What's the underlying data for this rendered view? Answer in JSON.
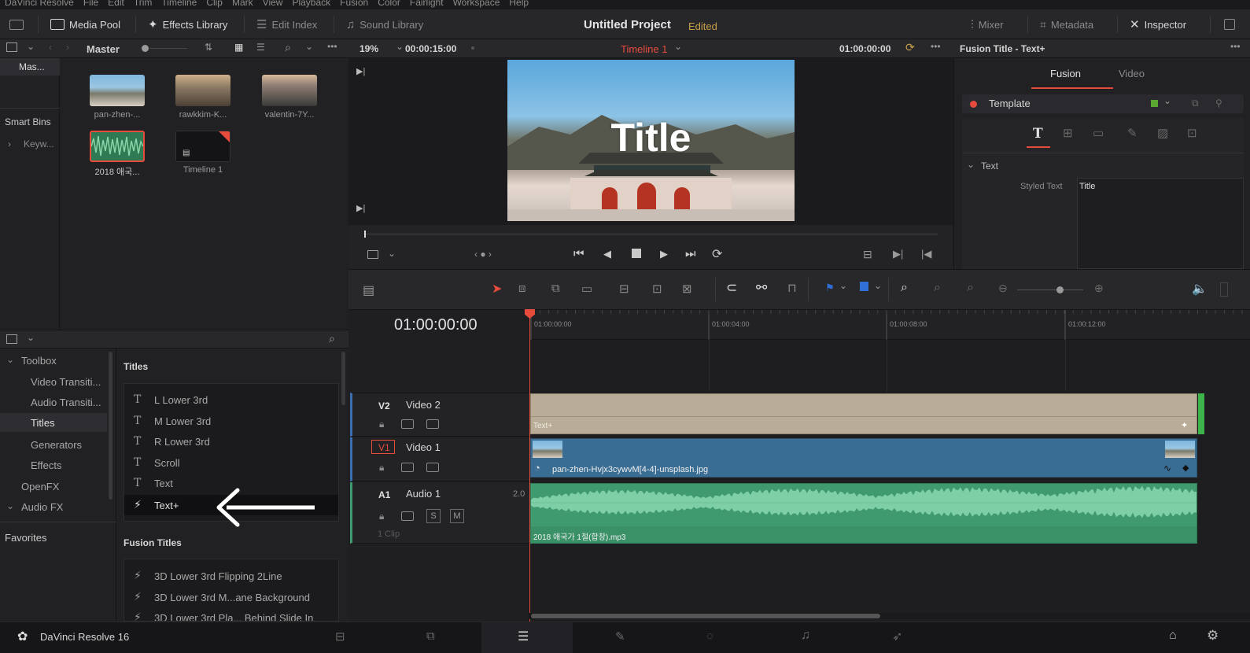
{
  "menubar": {
    "items": [
      "DaVinci Resolve",
      "File",
      "Edit",
      "Trim",
      "Timeline",
      "Clip",
      "Mark",
      "View",
      "Playback",
      "Fusion",
      "Color",
      "Fairlight",
      "Workspace",
      "Help"
    ]
  },
  "toolbar": {
    "media_pool": "Media Pool",
    "effects_library": "Effects Library",
    "edit_index": "Edit Index",
    "sound_library": "Sound Library",
    "project_title": "Untitled Project",
    "project_status": "Edited",
    "mixer": "Mixer",
    "metadata": "Metadata",
    "inspector": "Inspector"
  },
  "media_pool": {
    "bin_short": "Mas...",
    "bin_name": "Master",
    "smart_bins": "Smart Bins",
    "keywords": "Keyw...",
    "clips": [
      {
        "name": "pan-zhen-..."
      },
      {
        "name": "rawkkim-K..."
      },
      {
        "name": "valentin-7Y..."
      },
      {
        "name": "2018 애국..."
      },
      {
        "name": "Timeline 1"
      }
    ]
  },
  "viewer": {
    "zoom": "19%",
    "duration": "00:00:15:00",
    "timeline_name": "Timeline 1",
    "timecode": "01:00:00:00",
    "overlay_title": "Title"
  },
  "inspector": {
    "header": "Fusion Title - Text+",
    "tab_fusion": "Fusion",
    "tab_video": "Video",
    "template": "Template",
    "section_text": "Text",
    "styled_text_label": "Styled Text",
    "styled_text_value": "Title"
  },
  "effects": {
    "toolbox": "Toolbox",
    "categories": [
      "Video Transiti...",
      "Audio Transiti...",
      "Titles",
      "Generators",
      "Effects"
    ],
    "openfx": "OpenFX",
    "audiofx": "Audio FX",
    "favorites": "Favorites",
    "titles_header": "Titles",
    "titles": [
      "L Lower 3rd",
      "M Lower 3rd",
      "R Lower 3rd",
      "Scroll",
      "Text",
      "Text+"
    ],
    "fusion_titles_header": "Fusion Titles",
    "fusion_titles": [
      "3D Lower 3rd Flipping 2Line",
      "3D Lower 3rd M...ane Background",
      "3D Lower 3rd Pla... Behind Slide In"
    ]
  },
  "timeline": {
    "timecode": "01:00:00:00",
    "ruler": [
      "01:00:00:00",
      "01:00:04:00",
      "01:00:08:00",
      "01:00:12:00"
    ],
    "tracks": [
      {
        "id": "V2",
        "name": "Video 2"
      },
      {
        "id": "V1",
        "name": "Video 1"
      },
      {
        "id": "A1",
        "name": "Audio 1",
        "level": "2.0",
        "clip_count": "1 Clip",
        "solo": "S",
        "mute": "M"
      }
    ],
    "clip_v2": "Text+",
    "clip_v1": "pan-zhen-Hvjx3cywvM[4-4]-unsplash.jpg",
    "clip_a1": "2018 애국가 1절(합창).mp3"
  },
  "bottombar": {
    "app_name": "DaVinci Resolve 16"
  },
  "colors": {
    "accent_red": "#e64b3c",
    "v2_clip": "#b9ad97",
    "v1_clip": "#3a6d93",
    "a1_clip": "#3f9a6f",
    "edited": "#c8a04a"
  }
}
